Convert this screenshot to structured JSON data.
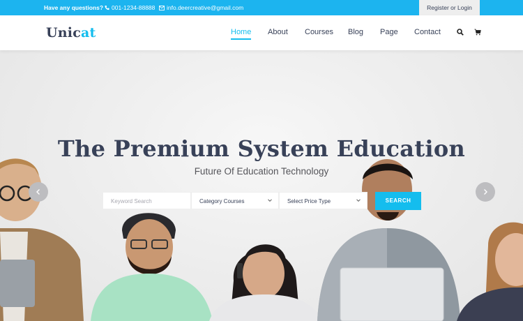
{
  "topbar": {
    "question": "Have any questions?",
    "phone": "001-1234-88888",
    "email": "info.deercreative@gmail.com",
    "register_login": "Register or Login"
  },
  "header": {
    "logo_main": "Unic",
    "logo_accent": "at",
    "nav": [
      {
        "label": "Home",
        "active": true
      },
      {
        "label": "About"
      },
      {
        "label": "Courses"
      },
      {
        "label": "Blog"
      },
      {
        "label": "Page"
      },
      {
        "label": "Contact"
      }
    ]
  },
  "hero": {
    "title": "The Premium System Education",
    "subtitle": "Future Of Education Technology",
    "search": {
      "keyword_placeholder": "Keyword Search",
      "category": "Category Courses",
      "price": "Select Price Type",
      "button": "SEARCH"
    }
  },
  "colors": {
    "accent": "#14bdee",
    "topbar": "#1cb4ef",
    "dark_text": "#384158"
  },
  "icons": [
    "phone-icon",
    "mail-icon",
    "search-icon",
    "cart-icon",
    "chevron-down-icon",
    "chevron-left-icon",
    "chevron-right-icon"
  ]
}
